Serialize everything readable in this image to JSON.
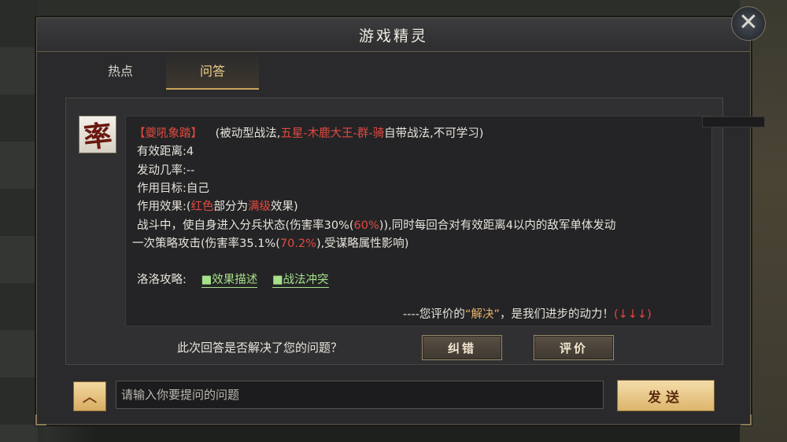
{
  "dialog": {
    "title": "游戏精灵",
    "close_icon": "close-icon"
  },
  "tabs": [
    {
      "label": "热点",
      "active": false
    },
    {
      "label": "问答",
      "active": true
    }
  ],
  "answer": {
    "avatar_glyph": "率",
    "skill_name": "【夔吼象踏】",
    "skill_desc_pre": "(被动型战法,",
    "skill_desc_red": "五星-木鹿大王-群-骑",
    "skill_desc_post": "自带战法,不可学习)",
    "range": "有效距离:4",
    "trigger": "发动几率:--",
    "target": "作用目标:自己",
    "effect_pre": "作用效果:(",
    "effect_red1": "红色",
    "effect_mid": "部分为",
    "effect_red2": "满级",
    "effect_post": "效果)",
    "line1_pre": "战斗中，使自身进入分兵状态(伤害率30%(",
    "line1_red": "60%",
    "line1_post": ")),同时每回合对有效距离4以内的敌军单体发动",
    "line2_pre": "一次策略攻击(伤害率35.1%(",
    "line2_red": "70.2%",
    "line2_post": "),受谋略属性影响)",
    "guide_label": "洛洛攻略:",
    "guide_links": [
      "■效果描述",
      "■战法冲突"
    ],
    "rate_pre": "----您评价的",
    "rate_gold": "“解决”",
    "rate_mid": "，是我们进步的动力！",
    "rate_red": "(↓↓↓)"
  },
  "feedback": {
    "question": "此次回答是否解决了您的问题？",
    "correct_label": "纠错",
    "rate_label": "评价"
  },
  "input": {
    "placeholder": "请输入你要提问的问题",
    "value": "",
    "expand_icon": "chevron-up-icon",
    "send_label": "发送"
  }
}
